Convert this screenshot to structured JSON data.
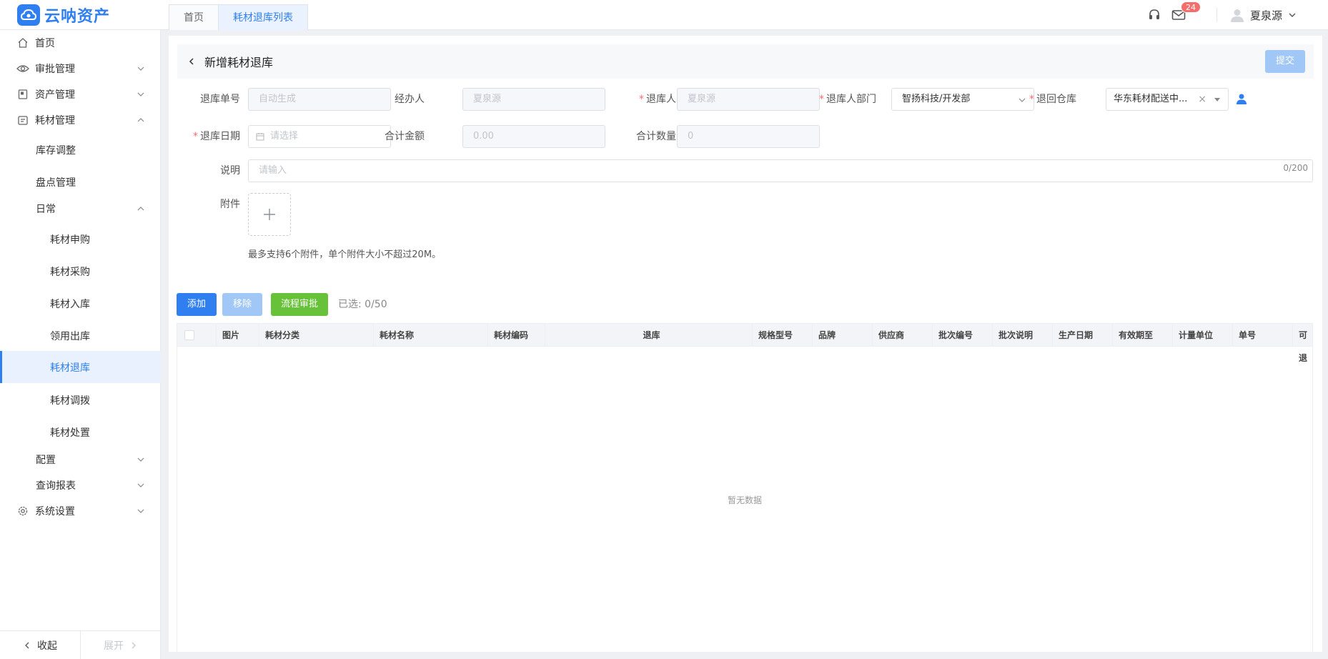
{
  "app": {
    "name": "云呐资产",
    "colors": {
      "primary": "#2f7ff0",
      "danger": "#f56c6c",
      "success": "#67c23a"
    }
  },
  "tabs": [
    {
      "label": "首页",
      "active": false
    },
    {
      "label": "耗材退库列表",
      "active": true
    }
  ],
  "header": {
    "badge_count": "24",
    "user_name": "夏泉源",
    "icons": [
      "headset-icon",
      "mail-icon",
      "user-avatar-icon",
      "chevron-down-icon"
    ]
  },
  "sidebar": {
    "items": [
      {
        "label": "首页",
        "icon": "home-icon",
        "level": 0
      },
      {
        "label": "审批管理",
        "icon": "eye-icon",
        "level": 0,
        "expand": "down"
      },
      {
        "label": "资产管理",
        "icon": "asset-icon",
        "level": 0,
        "expand": "down"
      },
      {
        "label": "耗材管理",
        "icon": "consumable-icon",
        "level": 0,
        "expand": "up"
      },
      {
        "label": "库存调整",
        "level": 1
      },
      {
        "label": "盘点管理",
        "level": 1
      },
      {
        "label": "日常",
        "level": 1,
        "expand": "up"
      },
      {
        "label": "耗材申购",
        "level": 2
      },
      {
        "label": "耗材采购",
        "level": 2
      },
      {
        "label": "耗材入库",
        "level": 2
      },
      {
        "label": "领用出库",
        "level": 2
      },
      {
        "label": "耗材退库",
        "level": 2,
        "active": true
      },
      {
        "label": "耗材调拨",
        "level": 2
      },
      {
        "label": "耗材处置",
        "level": 2
      },
      {
        "label": "配置",
        "level": 1,
        "expand": "down"
      },
      {
        "label": "查询报表",
        "level": 1,
        "expand": "down"
      },
      {
        "label": "系统设置",
        "icon": "gear-icon",
        "level": 0,
        "expand": "down"
      }
    ],
    "footer": {
      "collapse": "收起",
      "expand": "展开"
    }
  },
  "page": {
    "title": "新增耗材退库",
    "submit_label": "提交"
  },
  "form": {
    "order_no": {
      "label": "退库单号",
      "placeholder": "自动生成"
    },
    "handler": {
      "label": "经办人",
      "value": "夏泉源"
    },
    "returner": {
      "label": "退库人",
      "value": "夏泉源",
      "required": true
    },
    "returner_dept": {
      "label": "退库人部门",
      "value": "智扬科技/开发部",
      "required": true
    },
    "warehouse": {
      "label": "退回仓库",
      "value": "华东耗材配送中...",
      "required": true
    },
    "return_date": {
      "label": "退库日期",
      "placeholder": "请选择",
      "required": true
    },
    "total_amount": {
      "label": "合计金额",
      "value": "0.00"
    },
    "total_qty": {
      "label": "合计数量",
      "value": "0"
    },
    "remark": {
      "label": "说明",
      "placeholder": "请输入",
      "counter": "0/200"
    },
    "attachment": {
      "label": "附件",
      "hint": "最多支持6个附件，单个附件大小不超过20M。"
    }
  },
  "toolbar": {
    "add": "添加",
    "remove": "移除",
    "flow": "流程审批",
    "selected": "已选: 0/50"
  },
  "table": {
    "columns": [
      "图片",
      "耗材分类",
      "耗材名称",
      "耗材编码",
      "退库",
      "规格型号",
      "品牌",
      "供应商",
      "批次编号",
      "批次说明",
      "生产日期",
      "有效期至",
      "计量单位",
      "单号",
      "可退"
    ],
    "rows": [],
    "empty_text": "暂无数据"
  }
}
